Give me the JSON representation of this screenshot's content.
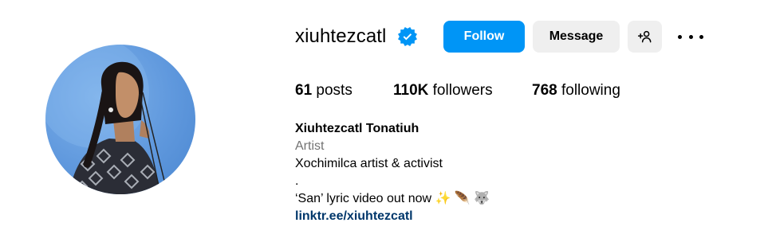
{
  "profile": {
    "username": "xiuhtezcatl",
    "verified": true,
    "avatar_alt": "xiuhtezcatl's profile picture"
  },
  "actions": {
    "follow_label": "Follow",
    "message_label": "Message",
    "add_user_icon": "person-plus-icon",
    "more_icon": "more-options-icon"
  },
  "stats": {
    "posts_count": "61",
    "posts_label": "posts",
    "followers_count": "110K",
    "followers_label": "followers",
    "following_count": "768",
    "following_label": "following"
  },
  "bio": {
    "full_name": "Xiuhtezcatl Tonatiuh",
    "category": "Artist",
    "line1": "Xochimilca artist & activist",
    "line2": ".",
    "line3": "‘San’ lyric video out now ✨ 🪶 🐺",
    "link": "linktr.ee/xiuhtezcatl"
  },
  "colors": {
    "primary_button": "#0095f6",
    "secondary_button": "#efefef",
    "verified_badge": "#0095f6",
    "link": "#00376b",
    "category": "#737373"
  }
}
